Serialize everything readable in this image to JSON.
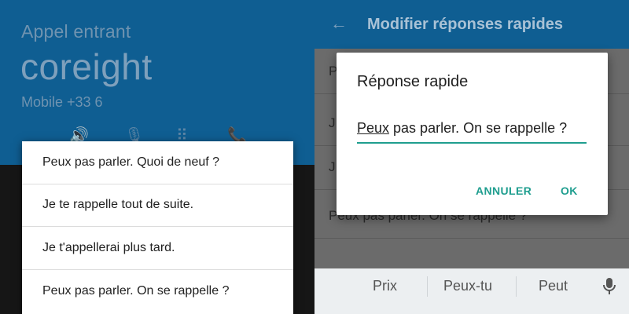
{
  "left": {
    "call_label": "Appel entrant",
    "caller_name": "coreight",
    "caller_number": "Mobile +33 6",
    "quick_replies": [
      "Peux pas parler. Quoi de neuf ?",
      "Je te rappelle tout de suite.",
      "Je t'appellerai plus tard.",
      "Peux pas parler. On se rappelle ?"
    ]
  },
  "right": {
    "appbar_title": "Modifier réponses rapides",
    "list_rows": [
      "P",
      "J",
      "J",
      "Peux pas parler. On se rappelle ?"
    ],
    "dialog": {
      "title": "Réponse rapide",
      "field_word_underlined": "Peux",
      "field_rest": " pas parler. On se rappelle ?",
      "cancel_label": "ANNULER",
      "ok_label": "OK"
    },
    "keyboard": {
      "suggestions": [
        "Prix",
        "Peux-tu",
        "Peut"
      ]
    }
  },
  "colors": {
    "appbar": "#0f5e92",
    "accent": "#1f9e8f"
  }
}
